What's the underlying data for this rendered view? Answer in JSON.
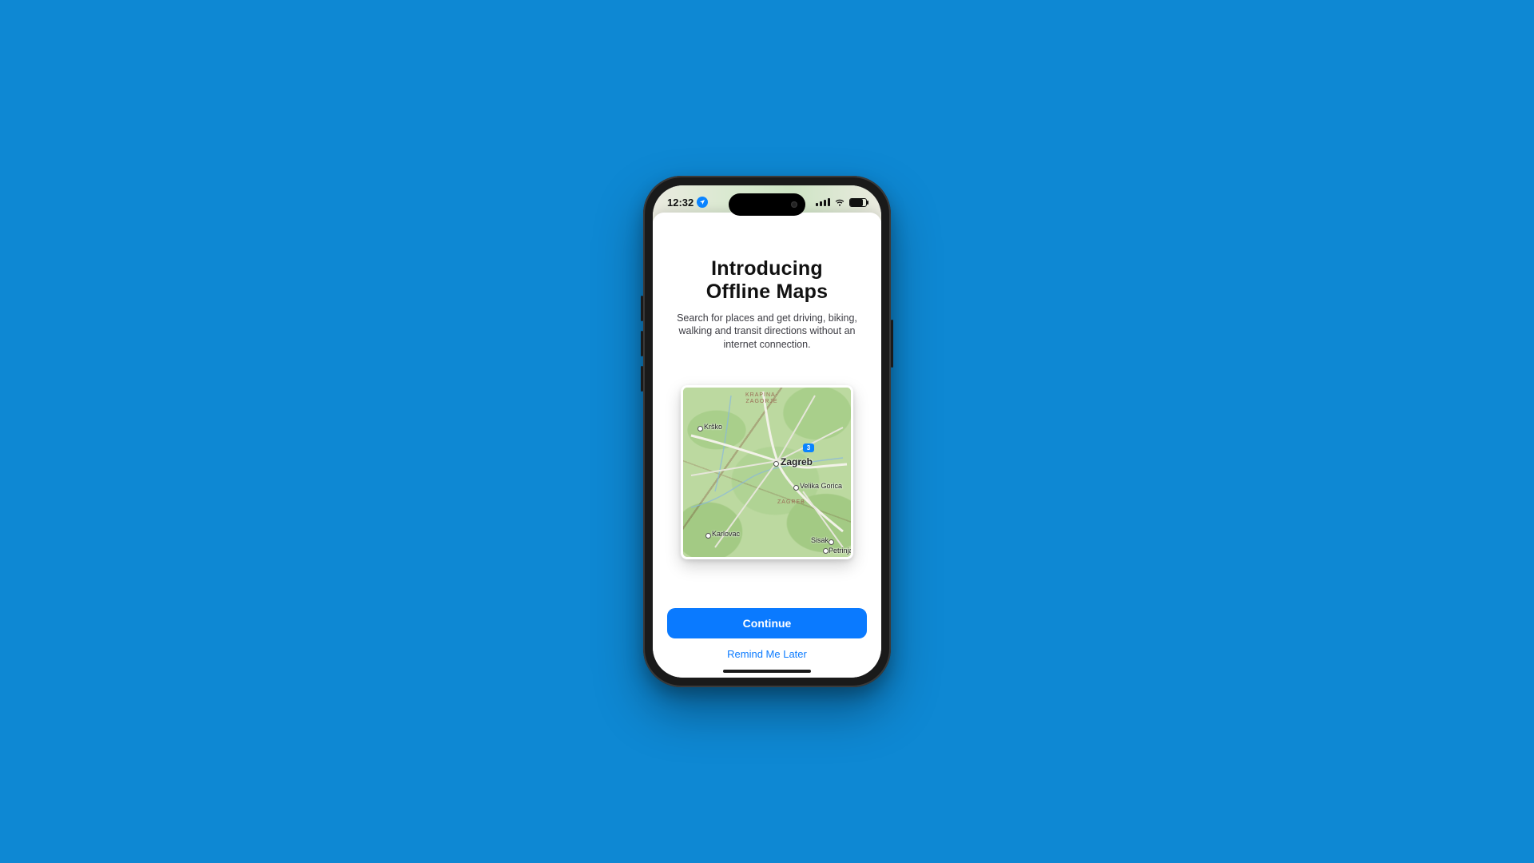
{
  "status_bar": {
    "time": "12:32",
    "location_active": true,
    "battery_pct": 80
  },
  "sheet": {
    "title_line1": "Introducing",
    "title_line2": "Offline Maps",
    "description": "Search for places and get driving, biking, walking and transit directions without an internet connection."
  },
  "map_preview": {
    "regions": {
      "top": "KRAPINA-\nZAGORJE",
      "mid": "ZAGREB"
    },
    "cities": {
      "main": "Zagreb",
      "nw": "Krško",
      "sw": "Karlovac",
      "e": "Velika Gorica",
      "se1": "Sisak",
      "se2": "Petrinja"
    },
    "route_shield": "3"
  },
  "buttons": {
    "primary": "Continue",
    "secondary": "Remind Me Later"
  }
}
